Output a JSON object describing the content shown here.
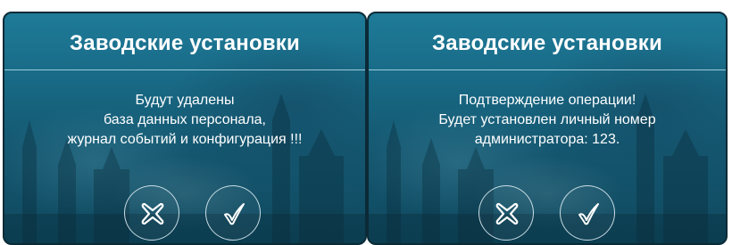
{
  "dialogs": [
    {
      "title": "Заводские установки",
      "message_lines": [
        "Будут удалены",
        "база данных персонала,",
        "журнал событий и конфигурация !!!"
      ],
      "cancel_icon": "cancel-x-icon",
      "confirm_icon": "checkmark-icon"
    },
    {
      "title": "Заводские установки",
      "message_lines": [
        "Подтверждение операции!",
        "Будет установлен личный номер",
        "администратора: 123."
      ],
      "cancel_icon": "cancel-x-icon",
      "confirm_icon": "checkmark-icon"
    }
  ],
  "colors": {
    "background": "#186985",
    "text": "#ffffff",
    "divider": "#c8ebf5"
  }
}
